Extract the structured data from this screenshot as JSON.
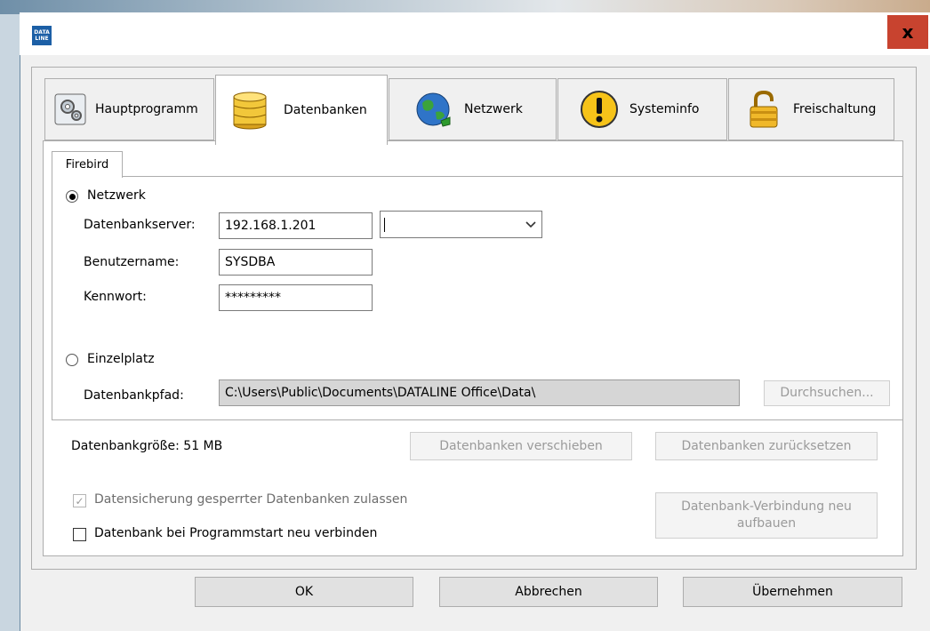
{
  "window": {
    "icon_text": "DATA LINE",
    "close_label": "x"
  },
  "tabs": [
    {
      "label": "Hauptprogramm",
      "icon": "gear-icon"
    },
    {
      "label": "Datenbanken",
      "icon": "database-icon"
    },
    {
      "label": "Netzwerk",
      "icon": "globe-icon"
    },
    {
      "label": "Systeminfo",
      "icon": "exclamation-icon"
    },
    {
      "label": "Freischaltung",
      "icon": "padlock-icon"
    }
  ],
  "active_tab": "Datenbanken",
  "subtab": {
    "label": "Firebird"
  },
  "firebird": {
    "network_radio": {
      "label": "Netzwerk",
      "selected": true
    },
    "server": {
      "label": "Datenbankserver:",
      "value": "192.168.1.201",
      "combo_value": ""
    },
    "username": {
      "label": "Benutzername:",
      "value": "SYSDBA"
    },
    "password": {
      "label": "Kennwort:",
      "value": "*********"
    },
    "local_radio": {
      "label": "Einzelplatz",
      "selected": false
    },
    "db_path": {
      "label": "Datenbankpfad:",
      "value": "C:\\Users\\Public\\Documents\\DATALINE Office\\Data\\"
    },
    "browse_button": "Durchsuchen..."
  },
  "db_size": "Datenbankgröße: 51 MB",
  "buttons": {
    "move_db": "Datenbanken verschieben",
    "reset_db": "Datenbanken zurücksetzen",
    "reconnect_line1": "Datenbank-Verbindung neu",
    "reconnect_line2": "aufbauen"
  },
  "checkboxes": {
    "backup_locked": {
      "label": "Datensicherung gesperrter Datenbanken zulassen",
      "checked": true,
      "disabled": true
    },
    "reconnect_on_start": {
      "label": "Datenbank bei Programmstart neu verbinden",
      "checked": false
    }
  },
  "footer": {
    "ok": "OK",
    "cancel": "Abbrechen",
    "apply": "Übernehmen"
  },
  "colors": {
    "close_button": "#c8432f",
    "app_icon": "#1c5fa6"
  }
}
